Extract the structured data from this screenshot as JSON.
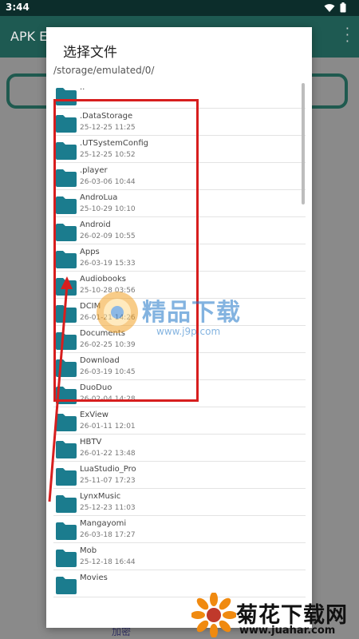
{
  "status_bar": {
    "time": "3:44"
  },
  "app": {
    "title": "APK E"
  },
  "dialog": {
    "title": "选择文件",
    "path": "/storage/emulated/0/",
    "items": [
      {
        "name": "..",
        "date": ""
      },
      {
        "name": ".DataStorage",
        "date": "25-12-25 11:25"
      },
      {
        "name": ".UTSystemConfig",
        "date": "25-12-25 10:52"
      },
      {
        "name": ".player",
        "date": "26-03-06 10:44"
      },
      {
        "name": "AndroLua",
        "date": "25-10-29 10:10"
      },
      {
        "name": "Android",
        "date": "26-02-09 10:55"
      },
      {
        "name": "Apps",
        "date": "26-03-19 15:33"
      },
      {
        "name": "Audiobooks",
        "date": "25-10-28 03:56"
      },
      {
        "name": "DCIM",
        "date": "26-01-21 14:26"
      },
      {
        "name": "Documents",
        "date": "26-02-25 10:39"
      },
      {
        "name": "Download",
        "date": "26-03-19 10:45"
      },
      {
        "name": "DuoDuo",
        "date": "26-02-04 14:28"
      },
      {
        "name": "ExView",
        "date": "26-01-11 12:01"
      },
      {
        "name": "HBTV",
        "date": "26-01-22 13:48"
      },
      {
        "name": "LuaStudio_Pro",
        "date": "25-11-07 17:23"
      },
      {
        "name": "LynxMusic",
        "date": "25-12-23 11:03"
      },
      {
        "name": "Mangayomi",
        "date": "26-03-18 17:27"
      },
      {
        "name": "Mob",
        "date": "25-12-18 16:44"
      },
      {
        "name": "Movies",
        "date": ""
      }
    ]
  },
  "bottom_peek_text": "加密",
  "watermarks": {
    "center_text": "精品下载",
    "center_url": "www.j9p.com",
    "corner_text": "菊花下载网",
    "corner_url": "www.juahar.com"
  },
  "colors": {
    "folder": "#1b7c8e",
    "annotation": "#d71e1e",
    "app_bar": "#1e5a52"
  }
}
